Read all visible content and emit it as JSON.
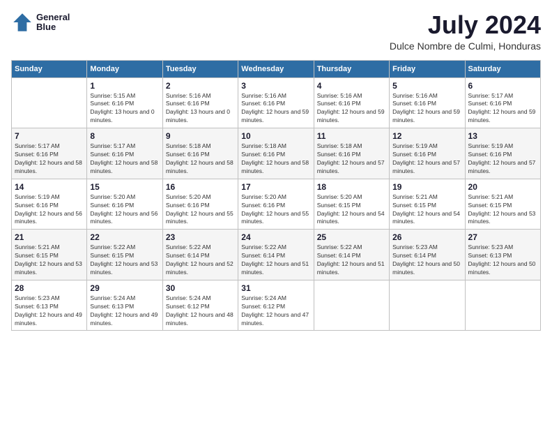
{
  "header": {
    "logo_line1": "General",
    "logo_line2": "Blue",
    "month_title": "July 2024",
    "location": "Dulce Nombre de Culmi, Honduras"
  },
  "weekdays": [
    "Sunday",
    "Monday",
    "Tuesday",
    "Wednesday",
    "Thursday",
    "Friday",
    "Saturday"
  ],
  "weeks": [
    [
      {
        "day": "",
        "sunrise": "",
        "sunset": "",
        "daylight": ""
      },
      {
        "day": "1",
        "sunrise": "Sunrise: 5:15 AM",
        "sunset": "Sunset: 6:16 PM",
        "daylight": "Daylight: 13 hours and 0 minutes."
      },
      {
        "day": "2",
        "sunrise": "Sunrise: 5:16 AM",
        "sunset": "Sunset: 6:16 PM",
        "daylight": "Daylight: 13 hours and 0 minutes."
      },
      {
        "day": "3",
        "sunrise": "Sunrise: 5:16 AM",
        "sunset": "Sunset: 6:16 PM",
        "daylight": "Daylight: 12 hours and 59 minutes."
      },
      {
        "day": "4",
        "sunrise": "Sunrise: 5:16 AM",
        "sunset": "Sunset: 6:16 PM",
        "daylight": "Daylight: 12 hours and 59 minutes."
      },
      {
        "day": "5",
        "sunrise": "Sunrise: 5:16 AM",
        "sunset": "Sunset: 6:16 PM",
        "daylight": "Daylight: 12 hours and 59 minutes."
      },
      {
        "day": "6",
        "sunrise": "Sunrise: 5:17 AM",
        "sunset": "Sunset: 6:16 PM",
        "daylight": "Daylight: 12 hours and 59 minutes."
      }
    ],
    [
      {
        "day": "7",
        "sunrise": "Sunrise: 5:17 AM",
        "sunset": "Sunset: 6:16 PM",
        "daylight": "Daylight: 12 hours and 58 minutes."
      },
      {
        "day": "8",
        "sunrise": "Sunrise: 5:17 AM",
        "sunset": "Sunset: 6:16 PM",
        "daylight": "Daylight: 12 hours and 58 minutes."
      },
      {
        "day": "9",
        "sunrise": "Sunrise: 5:18 AM",
        "sunset": "Sunset: 6:16 PM",
        "daylight": "Daylight: 12 hours and 58 minutes."
      },
      {
        "day": "10",
        "sunrise": "Sunrise: 5:18 AM",
        "sunset": "Sunset: 6:16 PM",
        "daylight": "Daylight: 12 hours and 58 minutes."
      },
      {
        "day": "11",
        "sunrise": "Sunrise: 5:18 AM",
        "sunset": "Sunset: 6:16 PM",
        "daylight": "Daylight: 12 hours and 57 minutes."
      },
      {
        "day": "12",
        "sunrise": "Sunrise: 5:19 AM",
        "sunset": "Sunset: 6:16 PM",
        "daylight": "Daylight: 12 hours and 57 minutes."
      },
      {
        "day": "13",
        "sunrise": "Sunrise: 5:19 AM",
        "sunset": "Sunset: 6:16 PM",
        "daylight": "Daylight: 12 hours and 57 minutes."
      }
    ],
    [
      {
        "day": "14",
        "sunrise": "Sunrise: 5:19 AM",
        "sunset": "Sunset: 6:16 PM",
        "daylight": "Daylight: 12 hours and 56 minutes."
      },
      {
        "day": "15",
        "sunrise": "Sunrise: 5:20 AM",
        "sunset": "Sunset: 6:16 PM",
        "daylight": "Daylight: 12 hours and 56 minutes."
      },
      {
        "day": "16",
        "sunrise": "Sunrise: 5:20 AM",
        "sunset": "Sunset: 6:16 PM",
        "daylight": "Daylight: 12 hours and 55 minutes."
      },
      {
        "day": "17",
        "sunrise": "Sunrise: 5:20 AM",
        "sunset": "Sunset: 6:16 PM",
        "daylight": "Daylight: 12 hours and 55 minutes."
      },
      {
        "day": "18",
        "sunrise": "Sunrise: 5:20 AM",
        "sunset": "Sunset: 6:15 PM",
        "daylight": "Daylight: 12 hours and 54 minutes."
      },
      {
        "day": "19",
        "sunrise": "Sunrise: 5:21 AM",
        "sunset": "Sunset: 6:15 PM",
        "daylight": "Daylight: 12 hours and 54 minutes."
      },
      {
        "day": "20",
        "sunrise": "Sunrise: 5:21 AM",
        "sunset": "Sunset: 6:15 PM",
        "daylight": "Daylight: 12 hours and 53 minutes."
      }
    ],
    [
      {
        "day": "21",
        "sunrise": "Sunrise: 5:21 AM",
        "sunset": "Sunset: 6:15 PM",
        "daylight": "Daylight: 12 hours and 53 minutes."
      },
      {
        "day": "22",
        "sunrise": "Sunrise: 5:22 AM",
        "sunset": "Sunset: 6:15 PM",
        "daylight": "Daylight: 12 hours and 53 minutes."
      },
      {
        "day": "23",
        "sunrise": "Sunrise: 5:22 AM",
        "sunset": "Sunset: 6:14 PM",
        "daylight": "Daylight: 12 hours and 52 minutes."
      },
      {
        "day": "24",
        "sunrise": "Sunrise: 5:22 AM",
        "sunset": "Sunset: 6:14 PM",
        "daylight": "Daylight: 12 hours and 51 minutes."
      },
      {
        "day": "25",
        "sunrise": "Sunrise: 5:22 AM",
        "sunset": "Sunset: 6:14 PM",
        "daylight": "Daylight: 12 hours and 51 minutes."
      },
      {
        "day": "26",
        "sunrise": "Sunrise: 5:23 AM",
        "sunset": "Sunset: 6:14 PM",
        "daylight": "Daylight: 12 hours and 50 minutes."
      },
      {
        "day": "27",
        "sunrise": "Sunrise: 5:23 AM",
        "sunset": "Sunset: 6:13 PM",
        "daylight": "Daylight: 12 hours and 50 minutes."
      }
    ],
    [
      {
        "day": "28",
        "sunrise": "Sunrise: 5:23 AM",
        "sunset": "Sunset: 6:13 PM",
        "daylight": "Daylight: 12 hours and 49 minutes."
      },
      {
        "day": "29",
        "sunrise": "Sunrise: 5:24 AM",
        "sunset": "Sunset: 6:13 PM",
        "daylight": "Daylight: 12 hours and 49 minutes."
      },
      {
        "day": "30",
        "sunrise": "Sunrise: 5:24 AM",
        "sunset": "Sunset: 6:12 PM",
        "daylight": "Daylight: 12 hours and 48 minutes."
      },
      {
        "day": "31",
        "sunrise": "Sunrise: 5:24 AM",
        "sunset": "Sunset: 6:12 PM",
        "daylight": "Daylight: 12 hours and 47 minutes."
      },
      {
        "day": "",
        "sunrise": "",
        "sunset": "",
        "daylight": ""
      },
      {
        "day": "",
        "sunrise": "",
        "sunset": "",
        "daylight": ""
      },
      {
        "day": "",
        "sunrise": "",
        "sunset": "",
        "daylight": ""
      }
    ]
  ]
}
